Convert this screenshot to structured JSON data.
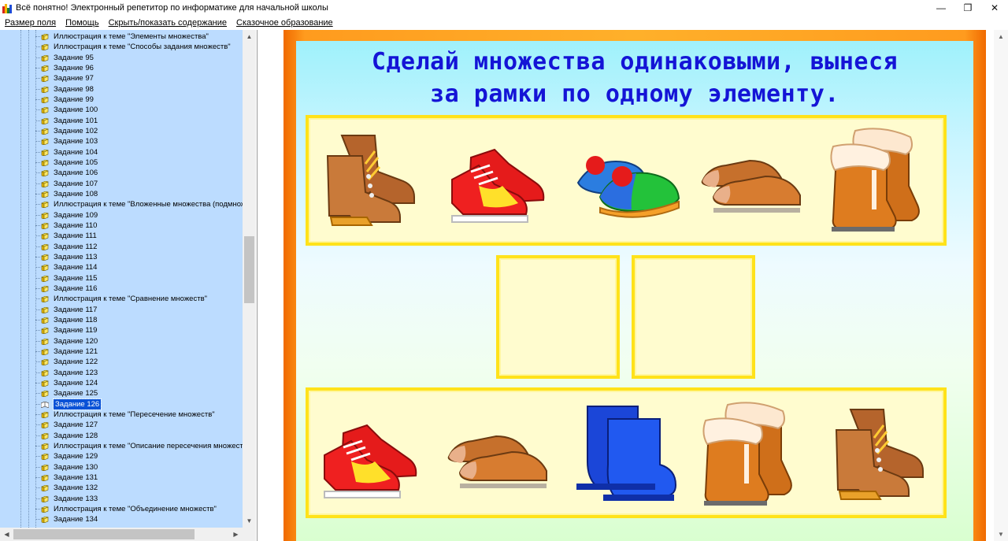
{
  "window": {
    "title": "Всё понятно! Электронный репетитор по информатике для начальной школы",
    "minimize": "—",
    "maximize": "❐",
    "close": "✕"
  },
  "menu": [
    "Размер поля",
    "Помощь",
    "Скрыть/показать содержание",
    "Сказочное образование"
  ],
  "tree": {
    "items": [
      "Иллюстрация к теме \"Элементы множества\"",
      "Иллюстрация к теме \"Способы задания множеств\"",
      "Задание 95",
      "Задание 96",
      "Задание 97",
      "Задание 98",
      "Задание 99",
      "Задание 100",
      "Задание 101",
      "Задание 102",
      "Задание 103",
      "Задание 104",
      "Задание 105",
      "Задание 106",
      "Задание 107",
      "Задание 108",
      "Иллюстрация к теме \"Вложенные множества (подмнож",
      "Задание 109",
      "Задание 110",
      "Задание 111",
      "Задание 112",
      "Задание 113",
      "Задание 114",
      "Задание 115",
      "Задание 116",
      "Иллюстрация к теме \"Сравнение множеств\"",
      "Задание 117",
      "Задание 118",
      "Задание 119",
      "Задание 120",
      "Задание 121",
      "Задание 122",
      "Задание 123",
      "Задание 124",
      "Задание 125",
      "Задание 126",
      "Иллюстрация к теме \"Пересечение множеств\"",
      "Задание 127",
      "Задание 128",
      "Иллюстрация к теме \"Описание пересечения множеств",
      "Задание 129",
      "Задание 130",
      "Задание 131",
      "Задание 132",
      "Задание 133",
      "Иллюстрация к теме \"Объединение множеств\"",
      "Задание 134"
    ],
    "selected": "Задание 126"
  },
  "task": {
    "title_line1": "Сделай множества одинаковыми, вынеся",
    "title_line2": "за рамки по одному элементу.",
    "top_items": [
      "boots-icon",
      "sneakers-icon",
      "slippers-icon",
      "shoes-icon",
      "fur-boots-icon"
    ],
    "bottom_items": [
      "sneakers-icon",
      "shoes-icon",
      "rubber-boots-icon",
      "fur-boots-icon",
      "boots-icon"
    ],
    "drop_slots": 2
  },
  "colors": {
    "tree_bg": "#bcdcff",
    "selection": "#0a52d6",
    "frame_orange": "#ff9b1e",
    "title_blue": "#1414d6",
    "shelf_yellow": "#ffe21a"
  }
}
